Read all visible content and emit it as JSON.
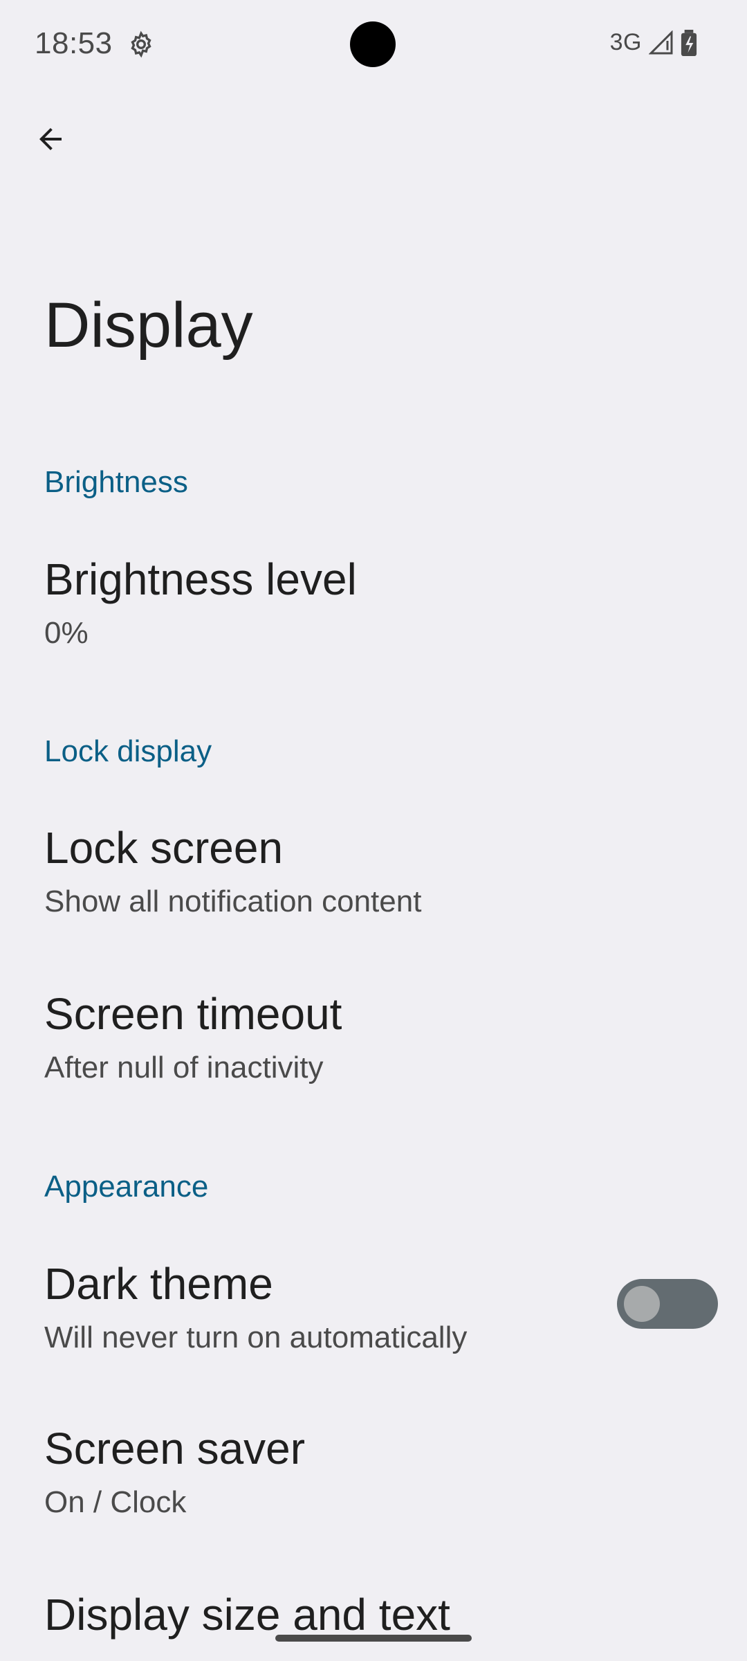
{
  "status": {
    "time": "18:53",
    "network": "3G"
  },
  "page": {
    "title": "Display"
  },
  "sections": {
    "brightness": {
      "header": "Brightness",
      "level_title": "Brightness level",
      "level_summary": "0%"
    },
    "lock_display": {
      "header": "Lock display",
      "lock_screen_title": "Lock screen",
      "lock_screen_summary": "Show all notification content",
      "timeout_title": "Screen timeout",
      "timeout_summary": "After null of inactivity"
    },
    "appearance": {
      "header": "Appearance",
      "dark_theme_title": "Dark theme",
      "dark_theme_summary": "Will never turn on automatically",
      "dark_theme_enabled": false,
      "screen_saver_title": "Screen saver",
      "screen_saver_summary": "On / Clock",
      "display_size_title": "Display size and text"
    }
  },
  "icons": {
    "status_gear": "gear-icon",
    "signal": "signal-icon",
    "battery": "battery-charging-icon",
    "back": "arrow-back-icon"
  },
  "colors": {
    "background": "#f0eff3",
    "category_accent": "#0b5f86",
    "toggle_track_off": "#636c71",
    "toggle_knob_off": "#a7aaab"
  }
}
